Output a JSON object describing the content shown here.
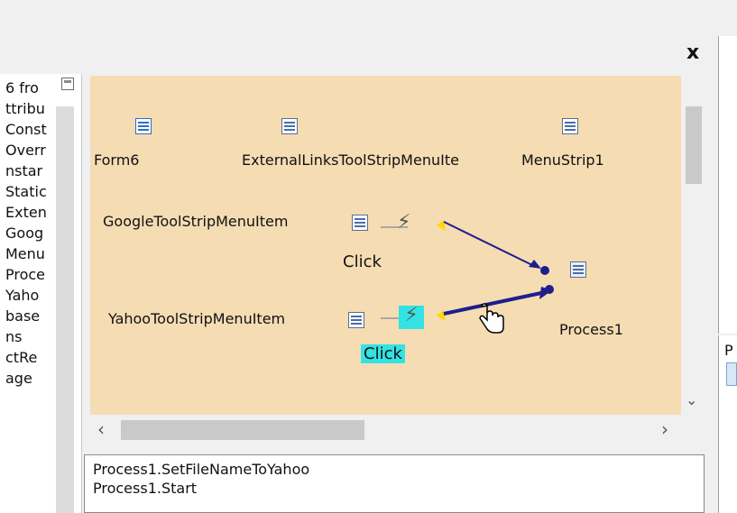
{
  "left_list": {
    "items": [
      "6 fro",
      "ttribu",
      "Const",
      "Overr",
      "nstar",
      "Static",
      "Exten",
      "Goog",
      "Menu",
      "Proce",
      "Yaho",
      "base",
      "ns",
      "ctRe",
      "age"
    ]
  },
  "designer": {
    "components": {
      "form": "Form6",
      "external_links": "ExternalLinksToolStripMenuIte",
      "menu_strip": "MenuStrip1",
      "google_item": "GoogleToolStripMenuItem",
      "yahoo_item": "YahooToolStripMenuItem",
      "process": "Process1"
    },
    "events": {
      "google_click": "Click",
      "yahoo_click": "Click"
    },
    "colors": {
      "canvas": "#f5dcb3",
      "highlight": "#33e3e3",
      "arrow": "#1e1e8c"
    }
  },
  "code": {
    "lines": [
      "Process1.SetFileNameToYahoo",
      "Process1.Start"
    ]
  },
  "window": {
    "close": "x"
  },
  "right_panel": {
    "label": "P"
  }
}
